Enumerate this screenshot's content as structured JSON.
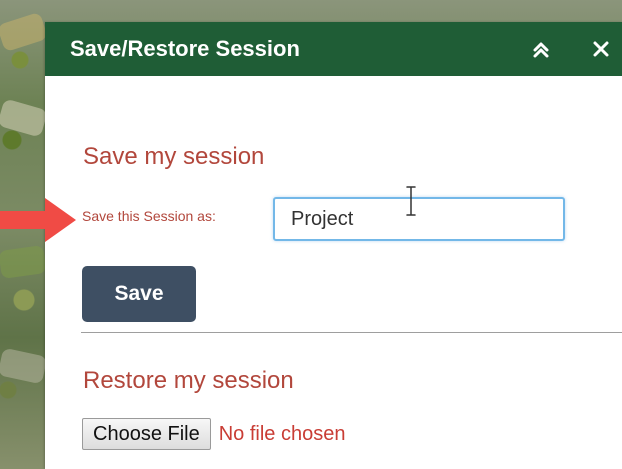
{
  "panel": {
    "title": "Save/Restore Session",
    "collapse_icon": "double-chevron-up-icon",
    "close_icon": "close-icon",
    "close_symbol": "✕"
  },
  "save_section": {
    "title": "Save my session",
    "label": "Save this Session as:",
    "input_value": "Project",
    "save_button_label": "Save"
  },
  "restore_section": {
    "title": "Restore my session",
    "choose_file_label": "Choose File",
    "file_status": "No file chosen"
  },
  "colors": {
    "header": "#1f5d36",
    "section_text": "#b2473c",
    "button": "#3e4f63",
    "input_focus": "#73b8e8",
    "arrow": "#f04b45"
  }
}
